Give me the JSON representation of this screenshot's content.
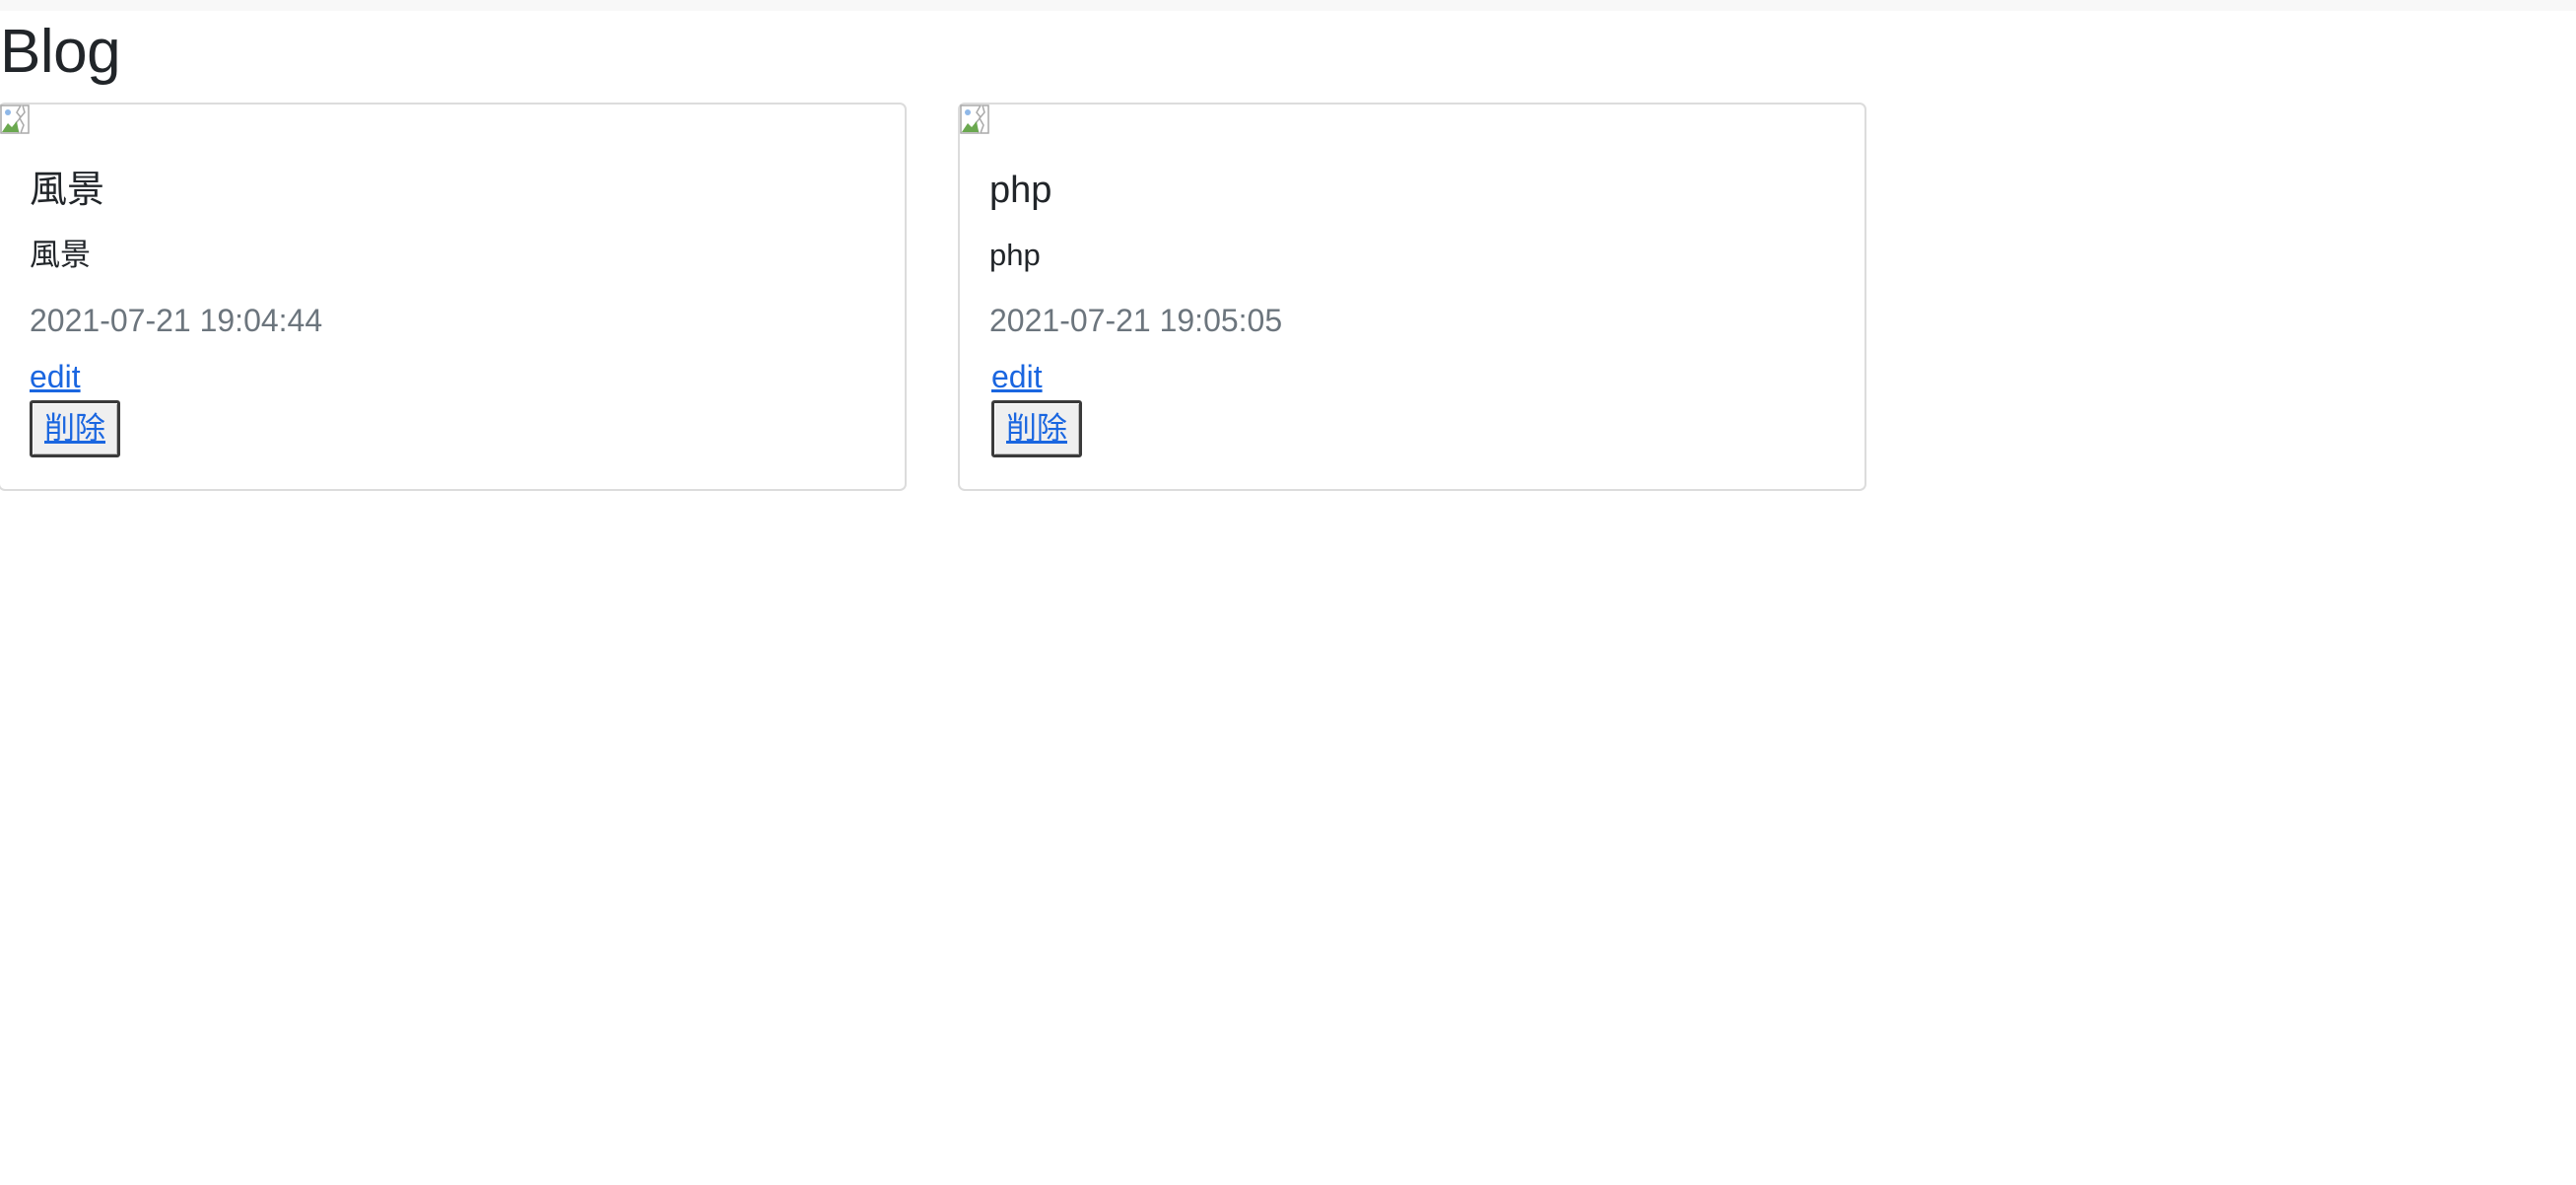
{
  "page": {
    "title": "Blog"
  },
  "posts": [
    {
      "title": "風景",
      "body": "風景",
      "date": "2021-07-21 19:04:44",
      "edit_label": "edit",
      "delete_label": "削除"
    },
    {
      "title": "php",
      "body": "php",
      "date": "2021-07-21 19:05:05",
      "edit_label": "edit",
      "delete_label": "削除"
    }
  ],
  "colors": {
    "link": "#1a66e0",
    "muted": "#6c757d",
    "text": "#212529",
    "card_border": "#dcdcdc"
  },
  "icons": {
    "card_image": "broken-image-icon"
  }
}
